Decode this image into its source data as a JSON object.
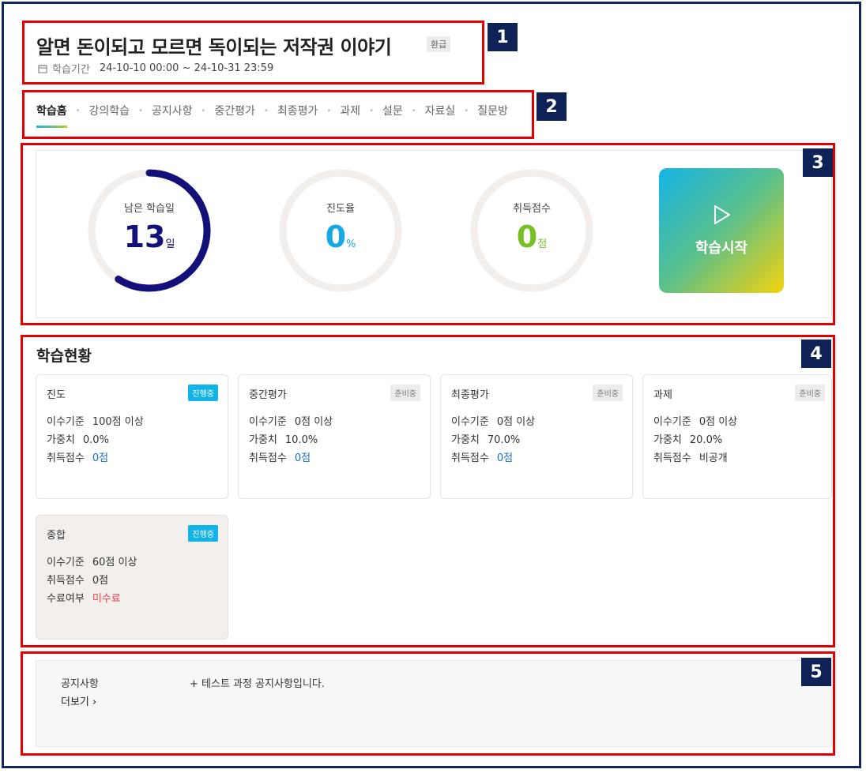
{
  "header": {
    "title": "알면 돈이되고 모르면 독이되는 저작권 이야기",
    "refund_badge": "환급",
    "period_label": "학습기간",
    "period_value": "24-10-10 00:00 ~ 24-10-31 23:59"
  },
  "annotations": [
    "1",
    "2",
    "3",
    "4",
    "5"
  ],
  "tabs": [
    {
      "label": "학습홈",
      "active": true
    },
    {
      "label": "강의학습"
    },
    {
      "label": "공지사항"
    },
    {
      "label": "중간평가"
    },
    {
      "label": "최종평가"
    },
    {
      "label": "과제"
    },
    {
      "label": "설문"
    },
    {
      "label": "자료실"
    },
    {
      "label": "질문방"
    }
  ],
  "stats": {
    "remaining": {
      "label": "남은 학습일",
      "value": "13",
      "unit": "일",
      "fraction": 0.59,
      "color": "#13107a"
    },
    "progress": {
      "label": "진도율",
      "value": "0",
      "unit": "%",
      "fraction": 0,
      "color": "#17a9e6"
    },
    "score": {
      "label": "취득점수",
      "value": "0",
      "unit": "점",
      "fraction": 0,
      "color": "#7bbf27"
    },
    "track_color": "#f1eeec",
    "start_label": "학습시작",
    "start_icon": "play-icon"
  },
  "status": {
    "title": "학습현황",
    "cards": [
      {
        "name": "진도",
        "badge": "진행중",
        "rows": [
          [
            "이수기준",
            "100점 이상"
          ],
          [
            "가중치",
            "0.0%"
          ],
          [
            "취득점수",
            "0점"
          ]
        ]
      },
      {
        "name": "중간평가",
        "badge": "준비중",
        "rows": [
          [
            "이수기준",
            "0점 이상"
          ],
          [
            "가중치",
            "10.0%"
          ],
          [
            "취득점수",
            "0점"
          ]
        ]
      },
      {
        "name": "최종평가",
        "badge": "준비중",
        "rows": [
          [
            "이수기준",
            "0점 이상"
          ],
          [
            "가중치",
            "70.0%"
          ],
          [
            "취득점수",
            "0점"
          ]
        ]
      },
      {
        "name": "과제",
        "badge": "준비중",
        "rows": [
          [
            "이수기준",
            "0점 이상"
          ],
          [
            "가중치",
            "20.0%"
          ],
          [
            "취득점수",
            "비공개"
          ]
        ]
      },
      {
        "name": "종합",
        "badge": "진행중",
        "rows": [
          [
            "이수기준",
            "60점 이상"
          ],
          [
            "취득점수",
            "0점"
          ],
          [
            "수료여부",
            "미수료"
          ]
        ]
      }
    ]
  },
  "notice": {
    "label": "공지사항",
    "more": "더보기 ›",
    "item": "+ 테스트 과정 공지사항입니다."
  }
}
